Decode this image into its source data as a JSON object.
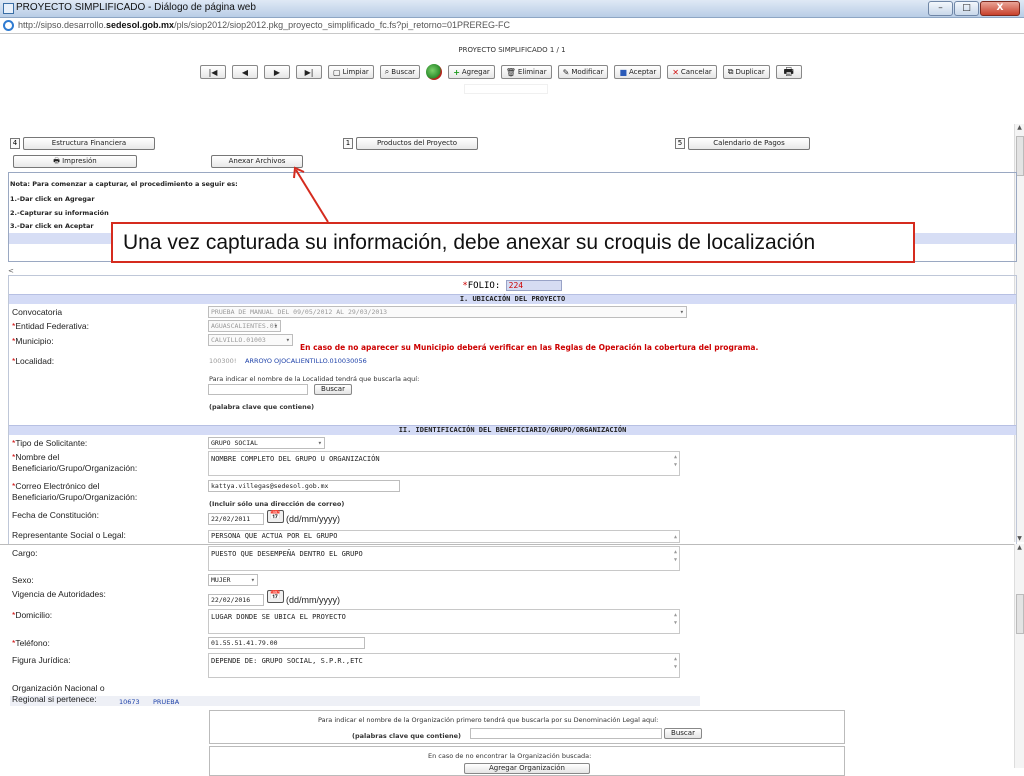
{
  "window": {
    "title": "PROYECTO SIMPLIFICADO - Diálogo de página web",
    "url_prefix": "http://sipso.desarrollo.",
    "url_domain": "sedesol.gob.mx",
    "url_rest": "/pls/siop2012/siop2012.pkg_proyecto_simplificado_fc.fs?pi_retorno=01PREREG-FC",
    "min": "–",
    "max": "□",
    "close": "X"
  },
  "header": {
    "title": "PROYECTO SIMPLIFICADO 1 / 1"
  },
  "toolbar": {
    "first": "|◀",
    "prev": "◀",
    "next": "▶",
    "last": "▶|",
    "limpiar": "Limpiar",
    "buscar": "Buscar",
    "agregar": "Agregar",
    "eliminar": "Eliminar",
    "modificar": "Modificar",
    "aceptar": "Aceptar",
    "cancelar": "Cancelar",
    "duplicar": "Duplicar"
  },
  "sections": {
    "s4_num": "4",
    "s4": "Estructura Financiera",
    "s1_num": "1",
    "s1": "Productos del Proyecto",
    "s5_num": "5",
    "s5": "Calendario de Pagos",
    "impresion": "Impresión",
    "anexar": "Anexar Archivos"
  },
  "notes": [
    "Nota: Para comenzar a capturar, el procedimiento a seguir es:",
    "1.-Dar click en Agregar",
    "2.-Capturar su información",
    "3.-Dar click en Aceptar"
  ],
  "callout": "Una vez capturada su información, debe anexar su croquis de localización",
  "scroll_lt": "<",
  "folio": {
    "label": "FOLIO:",
    "value": "224"
  },
  "section1": {
    "title": "I. UBICACIÓN DEL PROYECTO",
    "convocatoria_lbl": "Convocatoria",
    "convocatoria_val": "PRUEBA DE MANUAL DEL 09/05/2012 AL 29/03/2013",
    "entidad_lbl": "Entidad Federativa:",
    "entidad_val": "AGUASCALIENTES.01",
    "municipio_lbl": "Municipio:",
    "municipio_val": "CALVILLO.01003",
    "municipio_warn": "En caso de no aparecer su Municipio deberá verificar en las Reglas de Operación la cobertura del programa.",
    "localidad_lbl": "Localidad:",
    "localidad_code": "100300!",
    "localidad_val": "ARROYO OJOCALIENTILLO.010030056",
    "localidad_hint": "Para indicar el nombre de la Localidad tendrá que buscarla aquí:",
    "buscar": "Buscar",
    "palabra": "(palabra clave que contiene)"
  },
  "section2": {
    "title": "II. IDENTIFICACIÓN DEL BENEFICIARIO/GRUPO/ORGANIZACIÓN",
    "tipo_lbl": "Tipo de Solicitante:",
    "tipo_val": "GRUPO SOCIAL",
    "nombre_lbl1": "Nombre del",
    "nombre_lbl2": "Beneficiario/Grupo/Organización:",
    "nombre_val": "NOMBRE COMPLETO DEL GRUPO U ORGANIZACIÓN",
    "correo_lbl1": "Correo Electrónico del",
    "correo_lbl2": "Beneficiario/Grupo/Organización:",
    "correo_val": "kattya.villegas@sedesol.gob.mx",
    "correo_hint": "(Incluir sólo una dirección de correo)",
    "fecha_lbl": "Fecha de Constitución:",
    "fecha_val": "22/02/2011",
    "fmt": "(dd/mm/yyyy)",
    "rep_lbl": "Representante Social o Legal:",
    "rep_val": "PERSONA QUE ACTUA POR EL GRUPO",
    "cargo_lbl": "Cargo:",
    "cargo_val": "PUESTO QUE DESEMPEÑA DENTRO EL GRUPO",
    "sexo_lbl": "Sexo:",
    "sexo_val": "MUJER",
    "vig_lbl": "Vigencia de Autoridades:",
    "vig_val": "22/02/2016",
    "dom_lbl": "Domicilio:",
    "dom_val": "LUGAR DONDE SE UBICA EL PROYECTO",
    "tel_lbl": "Teléfono:",
    "tel_val": "01.55.51.41.79.00",
    "fig_lbl": "Figura Jurídica:",
    "fig_val": "DEPENDE DE: GRUPO SOCIAL, S.P.R.,ETC",
    "org_lbl1": "Organización Nacional o",
    "org_lbl2": "Regional si pertenece:",
    "org_code": "10673",
    "org_val": "PRUEBA",
    "org_hint": "Para indicar el nombre de la Organización primero tendrá que buscarla por su Denominación Legal aquí:",
    "org_kw": "(palabras clave que contiene)",
    "buscar": "Buscar",
    "no_enc": "En caso de no encontrar la Organización buscada:",
    "agregar_org": "Agregar Organización"
  }
}
